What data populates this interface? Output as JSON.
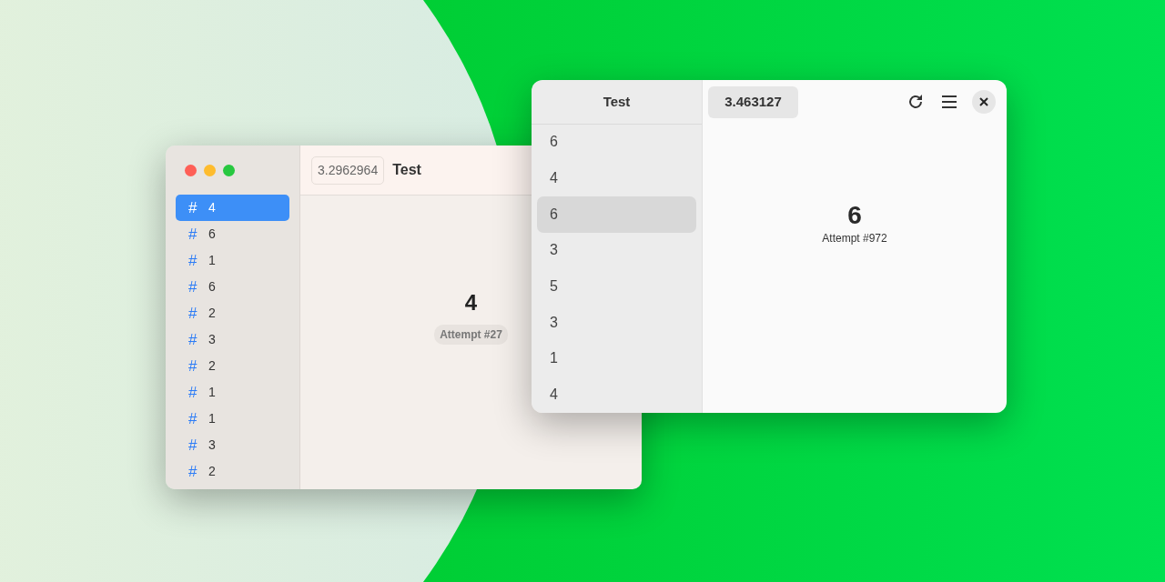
{
  "windows": [
    {
      "kind": "mac",
      "title": "Test",
      "value_badge": "3.2962964",
      "result": "4",
      "attempt": "Attempt #27",
      "sidebar": [
        {
          "symbol": "#",
          "label": "4",
          "selected": true
        },
        {
          "symbol": "#",
          "label": "6",
          "selected": false
        },
        {
          "symbol": "#",
          "label": "1",
          "selected": false
        },
        {
          "symbol": "#",
          "label": "6",
          "selected": false
        },
        {
          "symbol": "#",
          "label": "2",
          "selected": false
        },
        {
          "symbol": "#",
          "label": "3",
          "selected": false
        },
        {
          "symbol": "#",
          "label": "2",
          "selected": false
        },
        {
          "symbol": "#",
          "label": "1",
          "selected": false
        },
        {
          "symbol": "#",
          "label": "1",
          "selected": false
        },
        {
          "symbol": "#",
          "label": "3",
          "selected": false
        },
        {
          "symbol": "#",
          "label": "2",
          "selected": false
        }
      ]
    },
    {
      "kind": "gnome",
      "title": "Test",
      "value_badge": "3.463127",
      "result": "6",
      "attempt": "Attempt #972",
      "sidebar": [
        {
          "label": "6",
          "selected": false
        },
        {
          "label": "4",
          "selected": false
        },
        {
          "label": "6",
          "selected": true
        },
        {
          "label": "3",
          "selected": false
        },
        {
          "label": "5",
          "selected": false
        },
        {
          "label": "3",
          "selected": false
        },
        {
          "label": "1",
          "selected": false
        },
        {
          "label": "4",
          "selected": false
        }
      ]
    }
  ]
}
